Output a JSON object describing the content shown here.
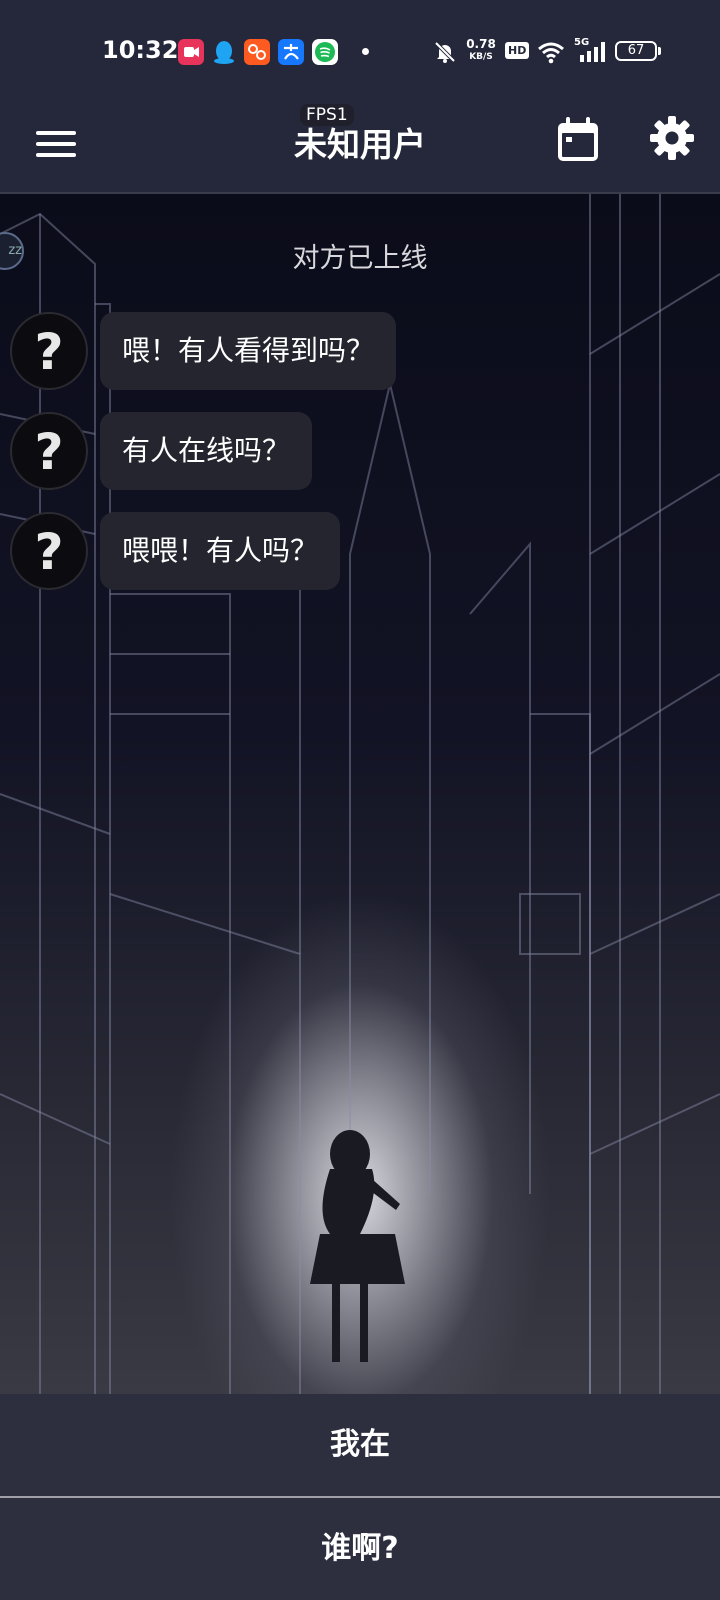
{
  "status_bar": {
    "time": "10:32",
    "network_speed_value": "0.78",
    "network_speed_unit": "KB/S",
    "hd_badge": "HD",
    "signal_label": "5G",
    "battery": "67",
    "app_icons": [
      "video-app-icon",
      "qq-icon",
      "taobao-icon",
      "alipay-icon",
      "spotify-icon"
    ],
    "status_icons": [
      "mute-bell-icon",
      "wifi-icon",
      "cellular-signal-icon",
      "battery-icon"
    ]
  },
  "header": {
    "title": "未知用户",
    "fps_overlay": "FPS1",
    "left_icon": "menu-icon",
    "right_icons": [
      "calendar-icon",
      "settings-icon"
    ]
  },
  "chat": {
    "system_note": "对方已上线",
    "messages": [
      {
        "sender_avatar": "?",
        "text": "喂！有人看得到吗？"
      },
      {
        "sender_avatar": "?",
        "text": "有人在线吗？"
      },
      {
        "sender_avatar": "?",
        "text": "喂喂！有人吗？"
      }
    ]
  },
  "replies": {
    "option1": "我在",
    "option2": "谁啊?"
  },
  "colors": {
    "bar_bg": "#25283a",
    "bubble_bg": "#25252f",
    "reply_bg": "#2d2f3f"
  }
}
